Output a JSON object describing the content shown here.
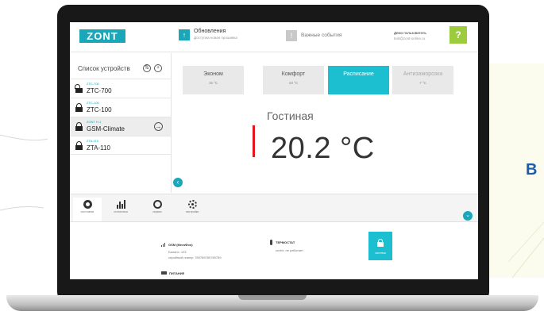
{
  "background": {
    "letter": "В"
  },
  "header": {
    "logo": "ZONT",
    "updates_title": "Обновления",
    "updates_sub": "Доступна новая прошивка",
    "events_title": "Важные события",
    "user_name": "Демо пользователь",
    "user_email": "test@zont-online.ru",
    "help_label": "?"
  },
  "sidebar": {
    "title": "Список устройств",
    "devices": [
      {
        "code": "ZTC-700",
        "name": "ZTC-700"
      },
      {
        "code": "ZTC-100",
        "name": "ZTC-100"
      },
      {
        "code": "ZONT H-1",
        "name": "GSM-Climate"
      },
      {
        "code": "ZTA-110",
        "name": "ZTA-110"
      }
    ]
  },
  "modes": [
    {
      "label": "Эконом",
      "temp": "15 °C"
    },
    {
      "label": "Комфорт",
      "temp": "23 °C"
    },
    {
      "label": "Расписание",
      "temp": ""
    },
    {
      "label": "Антизаморозка",
      "temp": "7 °C"
    }
  ],
  "room": {
    "name": "Гостиная",
    "temperature": "20.2 °C"
  },
  "tabs": [
    {
      "label": "состояние"
    },
    {
      "label": "статистика"
    },
    {
      "label": "сервис"
    },
    {
      "label": "настройки"
    }
  ],
  "details": {
    "gsm_title": "GSM (МегаФон)",
    "balance": "Баланс: 123",
    "serial": "серийный номер: 789789789789789",
    "power_title": "ПИТАНИЕ",
    "thermostat_title": "ТЕРМОСТАТ",
    "boiler_status": "котёл: не работает",
    "lock_label": "система"
  },
  "colors": {
    "accent": "#1bbfd0",
    "temp_bar": "#e3161d",
    "help": "#9ccc3d"
  }
}
